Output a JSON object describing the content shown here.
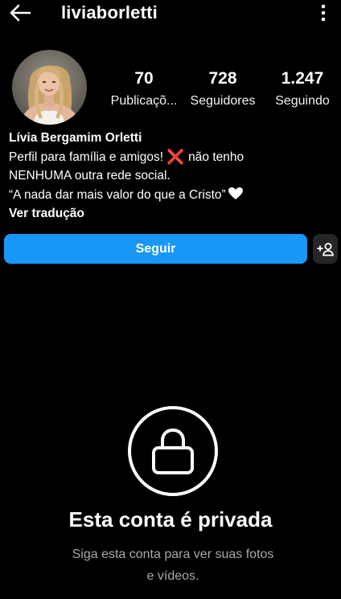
{
  "header": {
    "back_icon": "arrow-left-icon",
    "username": "liviaborletti",
    "menu_icon": "more-vertical-icon"
  },
  "profile": {
    "stats": {
      "posts": {
        "value": "70",
        "label": "Publicaçõ..."
      },
      "followers": {
        "value": "728",
        "label": "Seguidores"
      },
      "following": {
        "value": "1.247",
        "label": "Seguindo"
      }
    },
    "bio": {
      "name": "Lívia Bergamim Orletti",
      "line1_text": "Perfil para família e amigos! ",
      "line1_emoji": "❌",
      "line1_rest": " não tenho",
      "line2": "NENHUMA outra rede social.",
      "line3": "“A nada dar mais valor do que a Cristo”",
      "line3_emoji": "white-heart-icon",
      "translate": "Ver tradução"
    }
  },
  "actions": {
    "follow_label": "Seguir",
    "suggest_icon": "add-person-icon"
  },
  "private": {
    "lock_icon": "lock-icon",
    "title": "Esta conta é privada",
    "subtitle_line1": "Siga esta conta para ver suas fotos",
    "subtitle_line2": "e vídeos."
  },
  "colors": {
    "background": "#000000",
    "accent": "#1897f7",
    "secondary_button": "#262626",
    "muted_text": "#a8a8a8",
    "red_x": "#e0242b"
  }
}
